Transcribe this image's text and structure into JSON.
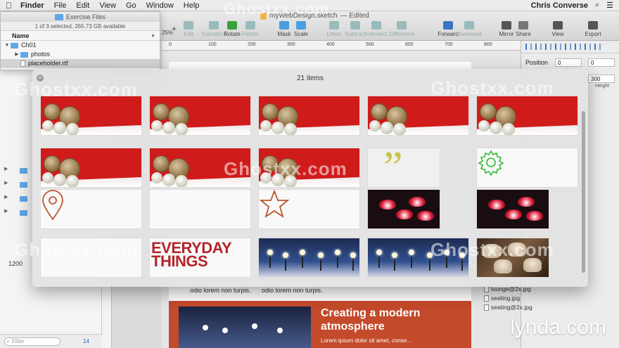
{
  "menubar": {
    "apple_icon": "apple-icon",
    "items": [
      "Finder",
      "File",
      "Edit",
      "View",
      "Go",
      "Window",
      "Help"
    ],
    "user": "Chris Converse"
  },
  "sketch": {
    "document_title": "myWebDesign.sketch",
    "edited_label": "— Edited",
    "toolbar": [
      {
        "label": "Edit",
        "icon": "edit-icon"
      },
      {
        "label": "Transform",
        "icon": "transform-icon"
      },
      {
        "label": "Rotate",
        "icon": "rotate-icon"
      },
      {
        "label": "Flatten",
        "icon": "flatten-icon"
      },
      {
        "label": "Mask",
        "icon": "mask-icon"
      },
      {
        "label": "Scale",
        "icon": "scale-icon"
      },
      {
        "label": "Union",
        "icon": "union-icon"
      },
      {
        "label": "Subtract",
        "icon": "subtract-icon"
      },
      {
        "label": "Intersect",
        "icon": "intersect-icon"
      },
      {
        "label": "Difference",
        "icon": "difference-icon"
      },
      {
        "label": "Forward",
        "icon": "forward-icon"
      },
      {
        "label": "Backward",
        "icon": "backward-icon"
      },
      {
        "label": "Mirror",
        "icon": "mirror-icon"
      },
      {
        "label": "Share",
        "icon": "share-icon"
      },
      {
        "label": "View",
        "icon": "view-icon"
      },
      {
        "label": "Export",
        "icon": "export-icon"
      }
    ],
    "zoom": "25%",
    "ruler_marks": [
      "0",
      "100",
      "200",
      "300",
      "400",
      "500",
      "600",
      "700",
      "800"
    ],
    "ruler_left_mark": "800",
    "layer_count": "1200",
    "filter_placeholder": "Filter",
    "filter_count": "14",
    "artboard": {
      "text_left": "odio lorem non turpis.",
      "text_right": "odio lorem non turpis.",
      "heading": "Creating a modern atmosphere",
      "body": "Lorem ipsum dolor sit amet, conse..."
    }
  },
  "finder": {
    "title": "Exercise Files",
    "status": "1 of 3 selected, 265.73 GB available",
    "column_name": "Name",
    "rows": [
      {
        "name": "Ch01",
        "kind": "folder",
        "expanded": true
      },
      {
        "name": "photos",
        "kind": "folder",
        "expanded": false
      },
      {
        "name": "placeholder.rtf",
        "kind": "file",
        "selected": true
      }
    ]
  },
  "inspector": {
    "position_label": "Position",
    "x_value": "0",
    "y_value": "0",
    "height_value": "300",
    "height_label": "Height",
    "files": [
      "lounge@2x.jpg",
      "seating.jpg",
      "seating@2x.jpg"
    ]
  },
  "quicklook": {
    "title": "21 items",
    "thumbnails": [
      {
        "kind": "balls"
      },
      {
        "kind": "balls"
      },
      {
        "kind": "balls"
      },
      {
        "kind": "balls"
      },
      {
        "kind": "balls"
      },
      {
        "kind": "balls"
      },
      {
        "kind": "balls"
      },
      {
        "kind": "balls"
      },
      {
        "kind": "quote-icon"
      },
      {
        "kind": "gear-icon"
      },
      {
        "kind": "location-pin-icon"
      },
      {
        "kind": "blank"
      },
      {
        "kind": "star-icon"
      },
      {
        "kind": "lamps"
      },
      {
        "kind": "lamps"
      },
      {
        "kind": "blank"
      },
      {
        "kind": "logo",
        "text": "EVERYDAY THINGS"
      },
      {
        "kind": "blue"
      },
      {
        "kind": "blue"
      },
      {
        "kind": "seating"
      }
    ]
  },
  "watermarks": {
    "brand": "Ghostxx.com",
    "lynda": "lynda.com"
  },
  "colors": {
    "accent_red": "#d01b1b",
    "brand_red": "#b5252a",
    "gear_green": "#2ebc2e",
    "quote_olive": "#c8c34a",
    "pin_brown": "#b8572c",
    "banner_orange": "#c34a2a"
  }
}
